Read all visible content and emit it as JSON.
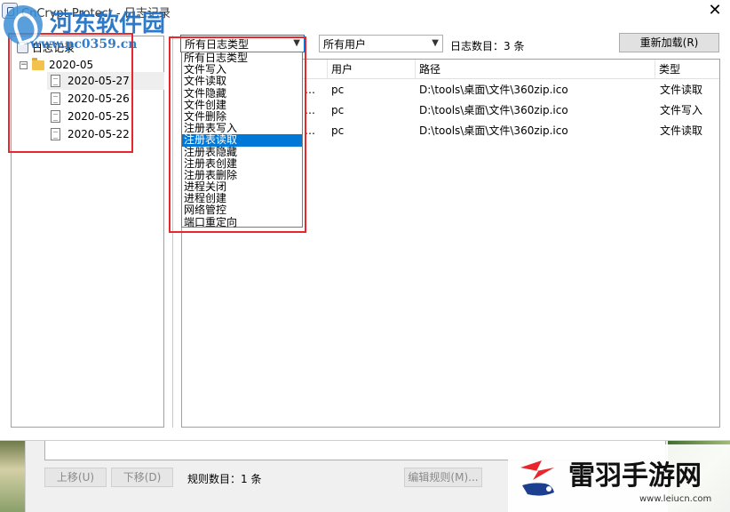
{
  "window": {
    "title": "CnCrypt Protect - 日志记录"
  },
  "tree": {
    "root_label": "日志记录",
    "month_label": "2020-05",
    "expander": "−",
    "dates": [
      "2020-05-27",
      "2020-05-26",
      "2020-05-25",
      "2020-05-22"
    ],
    "selected_index": 0
  },
  "toolbar": {
    "type_filter_value": "所有日志类型",
    "user_filter_value": "所有用户",
    "count_label": "日志数目：3 条",
    "reload_label": "重新加载(R)"
  },
  "dropdown": {
    "options": [
      "所有日志类型",
      "文件写入",
      "文件读取",
      "文件隐藏",
      "文件创建",
      "文件删除",
      "注册表写入",
      "注册表读取",
      "注册表隐藏",
      "注册表创建",
      "注册表删除",
      "进程关闭",
      "进程创建",
      "网络管控",
      "端口重定向"
    ],
    "highlighted_index": 7
  },
  "list": {
    "columns": {
      "time": "",
      "user": "用户",
      "path": "路径",
      "type": "类型"
    },
    "rows": [
      {
        "time_tail": "…",
        "user": "pc",
        "path": "D:\\tools\\桌面\\文件\\360zip.ico",
        "type": "文件读取"
      },
      {
        "time_tail": "…",
        "user": "pc",
        "path": "D:\\tools\\桌面\\文件\\360zip.ico",
        "type": "文件写入"
      },
      {
        "time_tail": "…",
        "user": "pc",
        "path": "D:\\tools\\桌面\\文件\\360zip.ico",
        "type": "文件读取"
      }
    ]
  },
  "background_window": {
    "move_up": "上移(U)",
    "move_down": "下移(D)",
    "rule_count": "规则数目：1 条",
    "edit_rule": "编辑规则(M)..."
  },
  "watermarks": {
    "top_name": "河东软件园",
    "top_url": "www.pc0359.cn",
    "bottom_name": "雷羽手游网",
    "bottom_url": "www.leiucn.com"
  },
  "colors": {
    "highlight": "#0078d7",
    "annotation_red": "#e8262b",
    "watermark_blue": "#1e6fc4"
  }
}
